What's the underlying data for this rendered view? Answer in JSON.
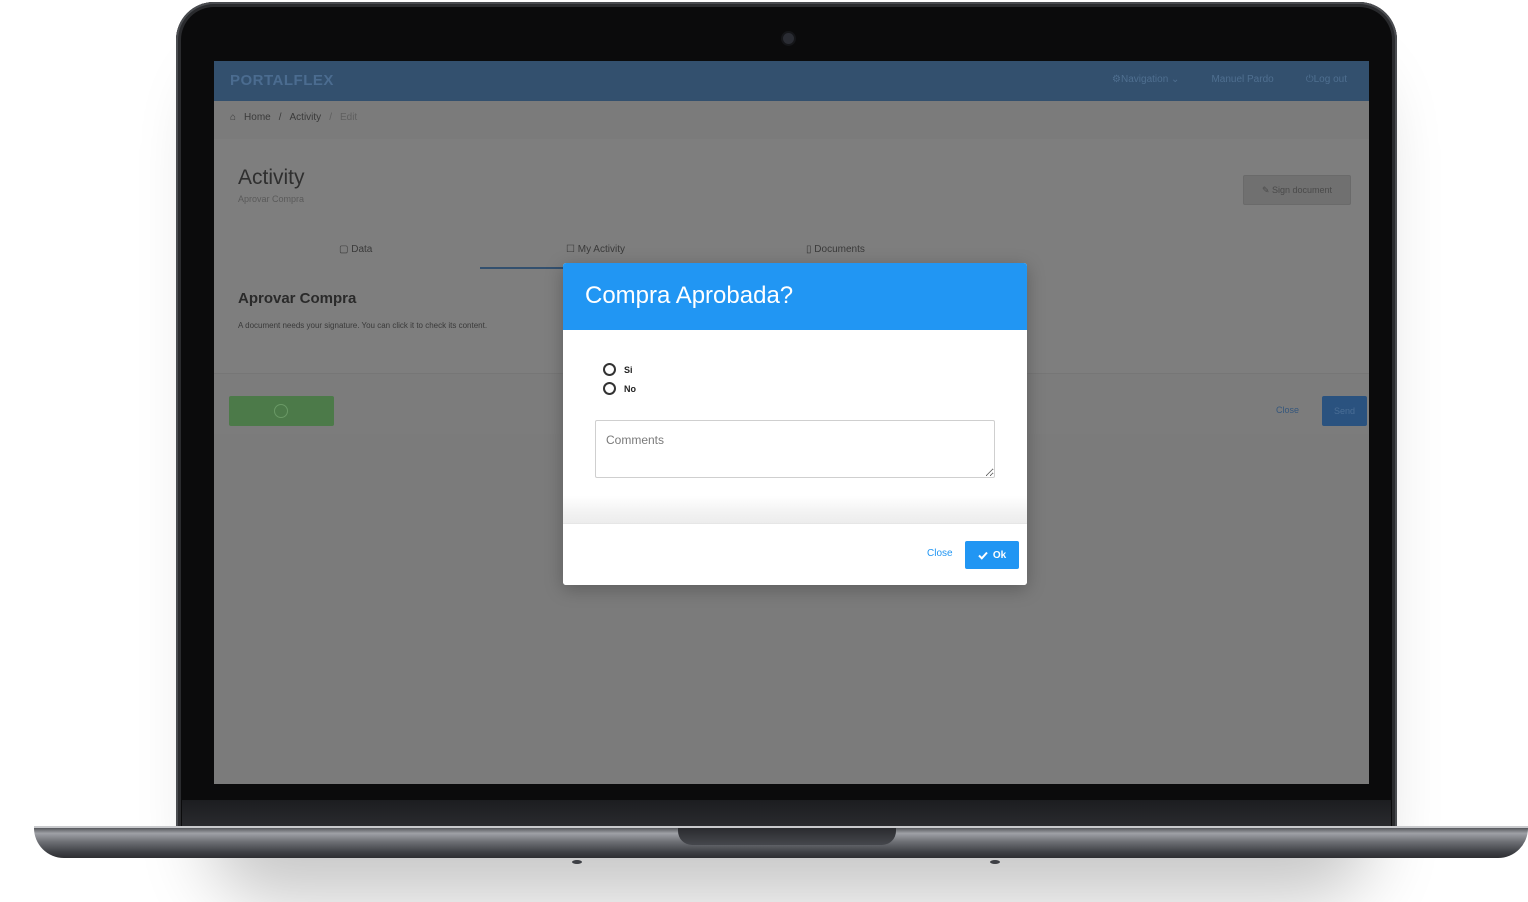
{
  "app": {
    "brand": "PORTALFLEX",
    "nav": {
      "navigation_label": "Navigation",
      "user_name": "Manuel Pardo",
      "logout_label": "Log out"
    },
    "breadcrumb": [
      "Home",
      "/",
      "Activity",
      "/",
      "Edit"
    ]
  },
  "page": {
    "title": "Activity",
    "subtitle": "Aprovar Compra",
    "sign_button": "Sign document",
    "tabs": [
      {
        "label": "Data",
        "icon": "edit-icon"
      },
      {
        "label": "My Activity",
        "icon": "check-icon",
        "active": true
      },
      {
        "label": "Documents",
        "icon": "document-icon"
      }
    ],
    "section_title": "Aprovar Compra",
    "section_text": "A document needs your signature. You can click it to check its content.",
    "footer": {
      "close_label": "Close",
      "send_label": "Send"
    }
  },
  "modal": {
    "title": "Compra Aprobada?",
    "options": [
      "Si",
      "No"
    ],
    "comments_placeholder": "Comments",
    "close_label": "Close",
    "ok_label": "Ok",
    "accent_color": "#2196f3"
  }
}
